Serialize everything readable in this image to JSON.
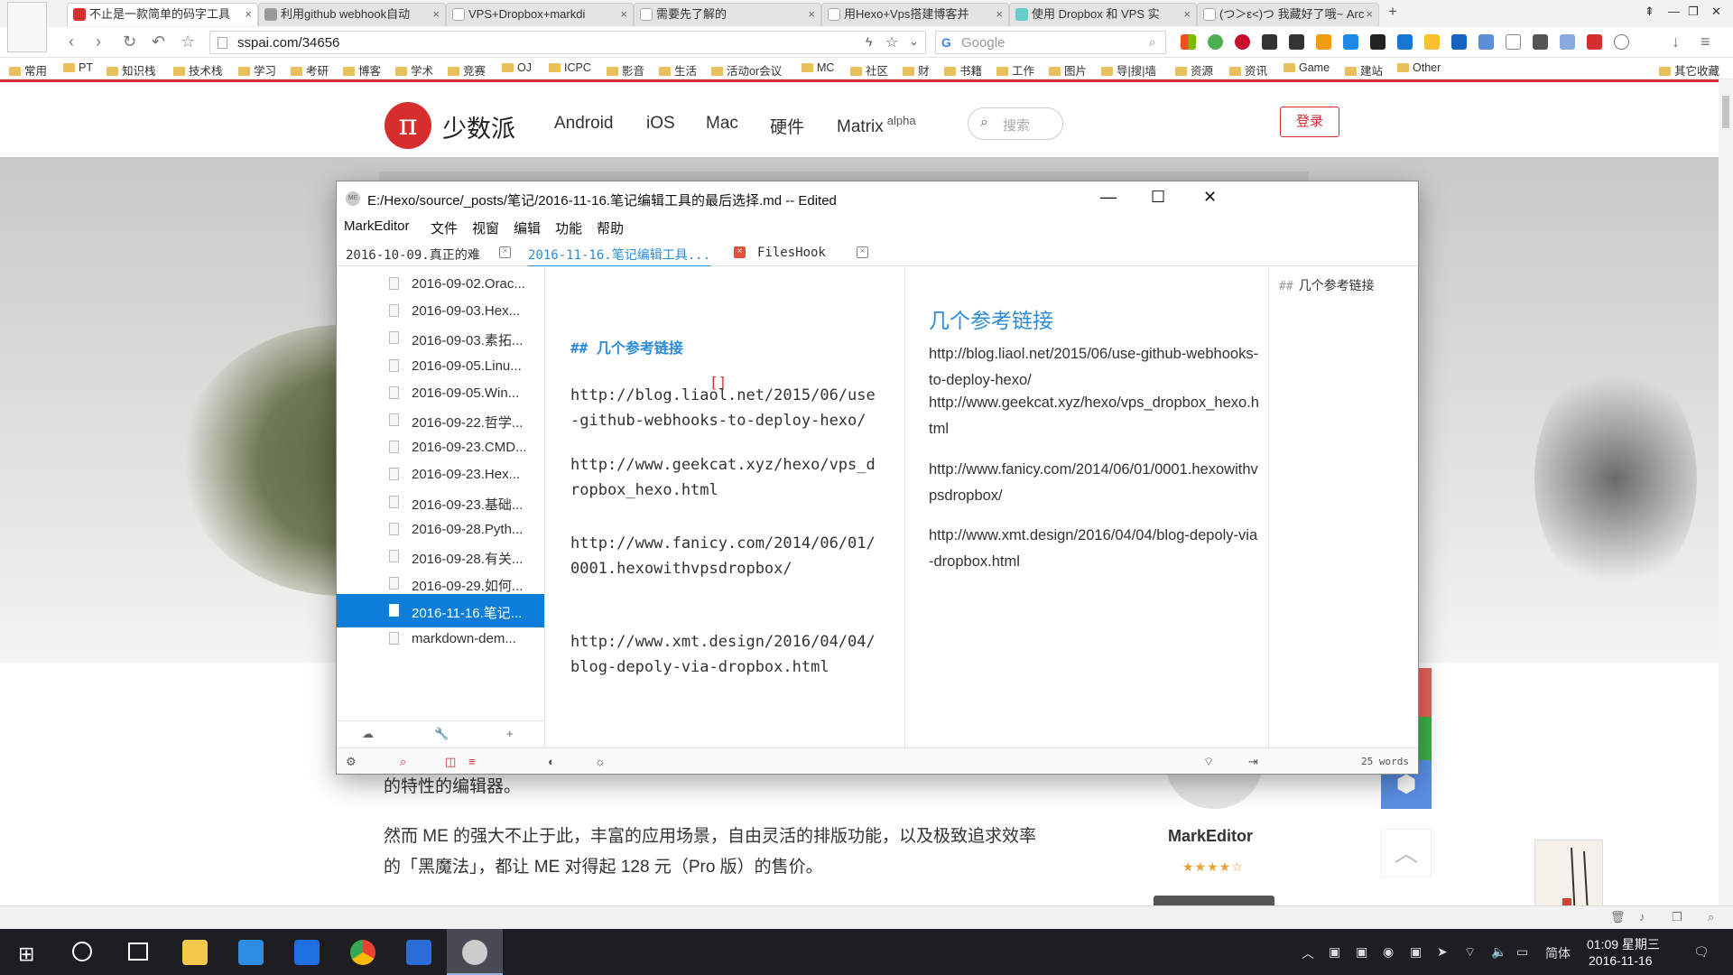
{
  "browser": {
    "tabs": [
      {
        "title": "不止是一款简单的码字工具",
        "active": true
      },
      {
        "title": "利用github webhook自动",
        "active": false
      },
      {
        "title": "VPS+Dropbox+markdi",
        "active": false
      },
      {
        "title": "需要先了解的",
        "active": false
      },
      {
        "title": "用Hexo+Vps搭建博客并",
        "active": false
      },
      {
        "title": "使用 Dropbox 和 VPS 实",
        "active": false
      },
      {
        "title": "(つ＞ε<)つ 我藏好了哦~ Arc",
        "active": false
      }
    ],
    "new_tab_label": "+",
    "url": "sspai.com/34656",
    "search_placeholder": "Google",
    "bookmarks": [
      "常用",
      "PT",
      "知识栈",
      "技术栈",
      "学习",
      "考研",
      "博客",
      "学术",
      "竞赛",
      "OJ",
      "ICPC",
      "影音",
      "生活",
      "活动or会议",
      "MC",
      "社区",
      "财",
      "书籍",
      "工作",
      "图片",
      "导|搜|墙",
      "资源",
      "资讯",
      "Game",
      "建站",
      "Other"
    ],
    "bookmarks_right": "其它收藏"
  },
  "site": {
    "logo_glyph": "π",
    "name": "少数派",
    "nav": [
      "Android",
      "iOS",
      "Mac",
      "硬件",
      "Matrix"
    ],
    "nav_superscript": "alpha",
    "search_placeholder": "搜索",
    "login_label": "登录",
    "article_line1": "的特性的编辑器。",
    "article_line2": "然而 ME 的强大不止于此，丰富的应用场景，自由灵活的排版功能，以及极致追求效率的「黑魔法」，都让 ME 对得起 128 元（Pro 版）的售价。",
    "app_card_name": "MarkEditor",
    "app_card_stars": "★★★★☆"
  },
  "editor": {
    "window_title": "E:/Hexo/source/_posts/笔记/2016-11-16.笔记编辑工具的最后选择.md -- Edited",
    "window_controls": {
      "minimize": "—",
      "maximize": "☐",
      "close": "✕"
    },
    "menu": [
      "MarkEditor",
      "文件",
      "视窗",
      "编辑",
      "功能",
      "帮助"
    ],
    "tabs": [
      {
        "label": "2016-10-09.真正的难",
        "active": false
      },
      {
        "label": "2016-11-16.笔记编辑工具...",
        "active": true
      },
      {
        "label": "FilesHook",
        "active": false
      }
    ],
    "files": [
      "2016-09-02.Orac...",
      "2016-09-03.Hex...",
      "2016-09-03.素拓...",
      "2016-09-05.Linu...",
      "2016-09-05.Win...",
      "2016-09-22.哲学...",
      "2016-09-23.CMD...",
      "2016-09-23.Hex...",
      "2016-09-23.基础...",
      "2016-09-28.Pyth...",
      "2016-09-28.有关...",
      "2016-09-29.如何...",
      "2016-11-16.笔记...",
      "markdown-dem..."
    ],
    "selected_file_index": 12,
    "source": {
      "heading": "## 几个参考链接",
      "bracket": "[]",
      "links": [
        "http://blog.liaol.net/2015/06/use-github-webhooks-to-deploy-hexo/",
        "http://www.geekcat.xyz/hexo/vps_dropbox_hexo.html",
        "http://www.fanicy.com/2014/06/01/0001.hexowithvpsdropbox/",
        "http://www.xmt.design/2016/04/04/blog-depoly-via-dropbox.html"
      ]
    },
    "preview": {
      "heading": "几个参考链接",
      "links": [
        "http://blog.liaol.net/2015/06/use-github-webhooks-to-deploy-hexo/",
        "http://www.geekcat.xyz/hexo/vps_dropbox_hexo.html",
        "http://www.fanicy.com/2014/06/01/0001.hexowithvpsdropbox/",
        "http://www.xmt.design/2016/04/04/blog-depoly-via-dropbox.html"
      ]
    },
    "outline": {
      "hash": "##",
      "item": "几个参考链接"
    },
    "status_words": "25 words"
  },
  "taskbar": {
    "ime_label": "简体",
    "time": "01:09 星期三",
    "date": "2016-11-16"
  },
  "colors": {
    "accent_red": "#d62d2d",
    "accent_blue": "#2b8bd8",
    "selection": "#0c7ed9"
  }
}
